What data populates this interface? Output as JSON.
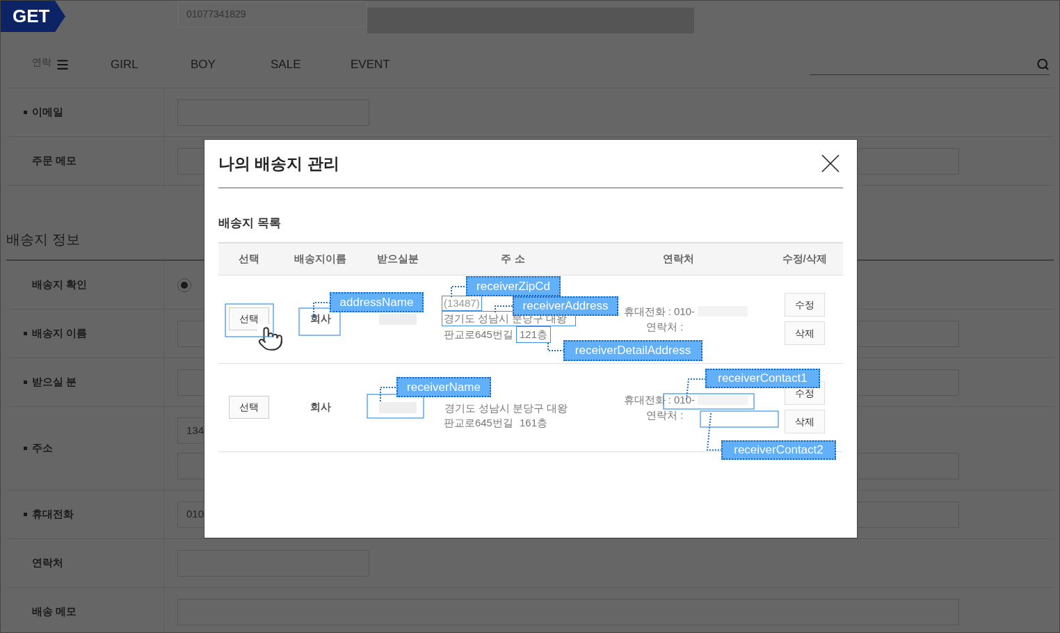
{
  "logo": "GET",
  "header": {
    "phone_value": "01077341829",
    "faded_label": "연락"
  },
  "nav": {
    "items": [
      "GIRL",
      "BOY",
      "SALE",
      "EVENT"
    ]
  },
  "form_top": [
    {
      "label": "이메일",
      "required": true,
      "kind": "short"
    },
    {
      "label": "주문 메모",
      "required": false,
      "kind": "long"
    }
  ],
  "section_title": "배송지 정보",
  "form_rows": [
    {
      "label": "배송지 확인",
      "required": false,
      "kind": "radio",
      "selected": true
    },
    {
      "label": "배송지 이름",
      "required": true,
      "kind": "text"
    },
    {
      "label": "받으실 분",
      "required": true,
      "kind": "text"
    },
    {
      "label": "주소",
      "required": true,
      "kind": "address",
      "value": "134"
    },
    {
      "label": "휴대전화",
      "required": true,
      "kind": "text",
      "value": "010"
    },
    {
      "label": "연락처",
      "required": false,
      "kind": "short"
    },
    {
      "label": "배송 메모",
      "required": false,
      "kind": "long"
    }
  ],
  "modal": {
    "title": "나의 배송지 관리",
    "subtitle": "배송지 목록",
    "columns": [
      "선택",
      "배송지이름",
      "받으실분",
      "주 소",
      "연락처",
      "수정/삭제"
    ],
    "rows": [
      {
        "select": "선택",
        "address_name": "회사",
        "zip": "(13487)",
        "address": "경기도 성남시 분당구 대왕",
        "address_street": "판교로645번길",
        "address_detail": "121층",
        "mobile_label": "휴대전화 :",
        "mobile": "010-",
        "phone_label": "연락처 :",
        "actions": [
          "수정",
          "삭제"
        ],
        "pointer": true
      },
      {
        "select": "선택",
        "address_name": "회사",
        "address": "경기도 성남시 분당구 대왕",
        "address_street": "판교로645번길",
        "address_detail": "161층",
        "mobile_label": "휴대전화 :",
        "mobile": "010-",
        "phone_label": "연락처 :",
        "actions": [
          "수정",
          "삭제"
        ],
        "pointer": false
      }
    ]
  },
  "annotations": [
    {
      "text": "receiverZipCd"
    },
    {
      "text": "addressName"
    },
    {
      "text": "receiverAddress"
    },
    {
      "text": "receiverDetailAddress"
    },
    {
      "text": "receiverName"
    },
    {
      "text": "receiverContact1"
    },
    {
      "text": "receiverContact2"
    }
  ]
}
